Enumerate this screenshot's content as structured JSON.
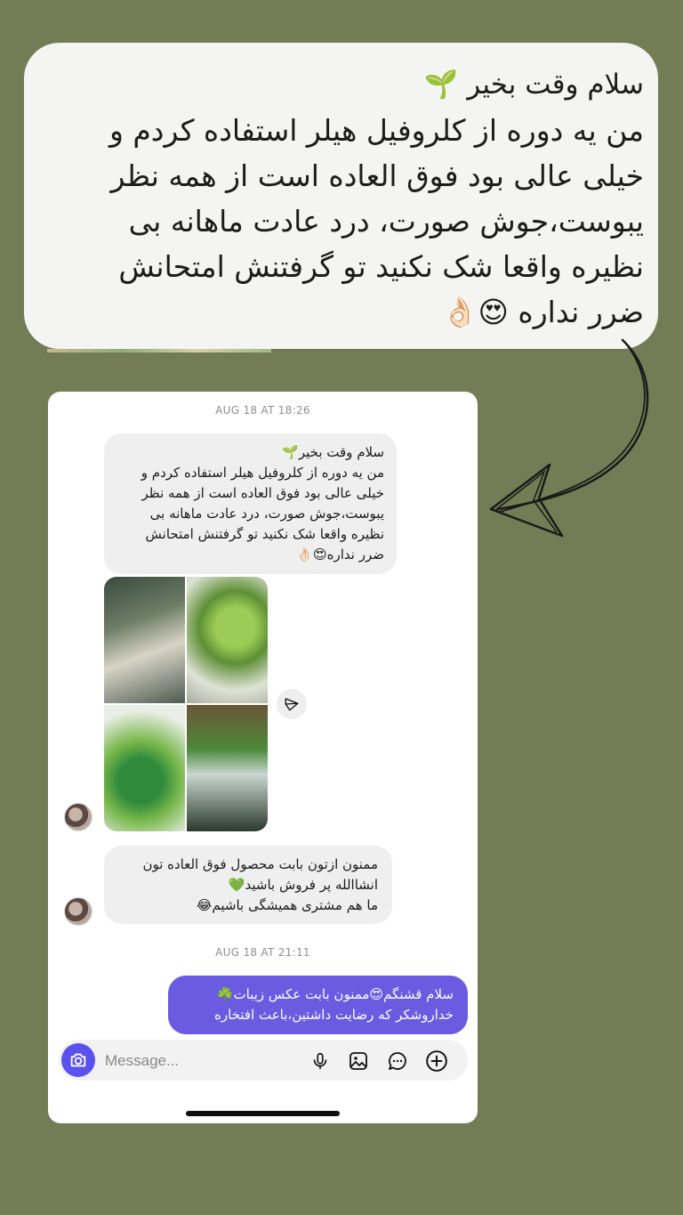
{
  "callout": {
    "greeting": "سلام وقت بخیر 🌱",
    "body": "من یه دوره از کلروفیل هیلر استفاده کردم و\nخیلی عالی بود فوق العاده است از همه نظر\nیبوست،جوش صورت، درد عادت ماهانه بی\nنظیره واقعا شک نکنید تو گرفتنش امتحانش\nضرر نداره 😍👌🏻"
  },
  "chat": {
    "timestamp_1": "AUG 18 AT 18:26",
    "message_1": "سلام وقت بخیر🌱\nمن یه دوره از کلروفیل هیلر استفاده کردم و\nخیلی عالی بود فوق العاده است از همه نظر\nیبوست،جوش صورت، درد عادت ماهانه بی\nنظیره واقعا شک نکنید تو گرفتنش امتحانش\nضرر نداره😍👌🏻",
    "photo_alt": [
      "product box photo",
      "serum bottle with plant",
      "green drink glass",
      "product set photo"
    ],
    "message_2": "ممنون ازتون بابت محصول فوق العاده تون\nانشاالله پر فروش باشید💚\nما هم مشتری همیشگی باشیم😂",
    "timestamp_2": "AUG 18 AT 21:11",
    "reply": "سلام قشنگم😍ممنون بابت عکس زیبات☘️\nخداروشکر که رضایت داشتین،باعث افتخاره"
  },
  "composer": {
    "placeholder": "Message...",
    "icons": [
      "camera-icon",
      "microphone-icon",
      "gallery-icon",
      "sticker-icon",
      "plus-icon"
    ]
  },
  "colors": {
    "background": "#747c55",
    "outgoing_bubble": "#6a5be0",
    "camera_button": "#5b52ee",
    "incoming_bubble": "#efefef"
  }
}
